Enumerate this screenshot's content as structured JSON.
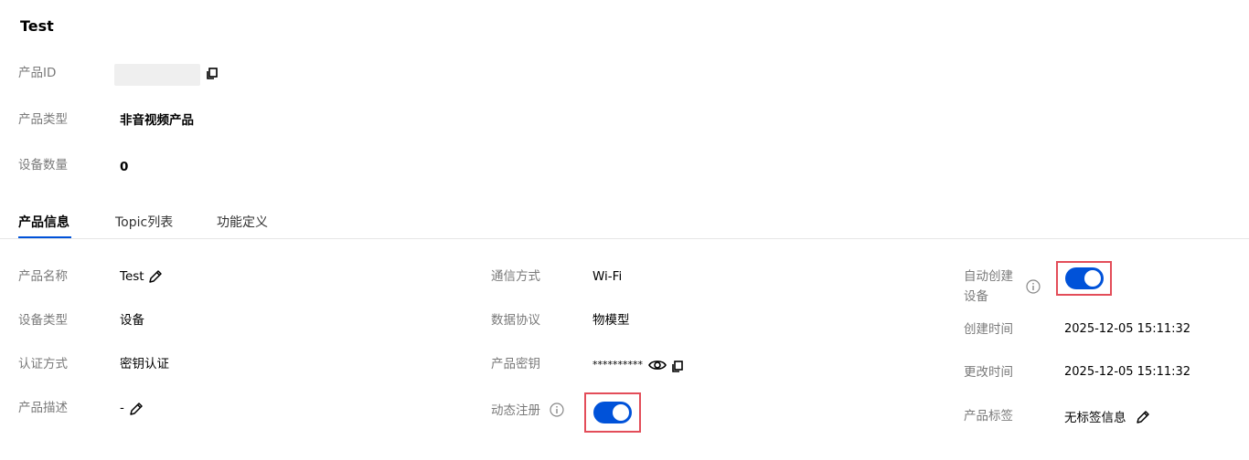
{
  "header": {
    "title": "Test"
  },
  "summary": {
    "product_id_label": "产品ID",
    "product_type_label": "产品类型",
    "product_type_value": "非音视频产品",
    "device_count_label": "设备数量",
    "device_count_value": "0"
  },
  "tabs": [
    {
      "label": "产品信息",
      "active": true
    },
    {
      "label": "Topic列表",
      "active": false
    },
    {
      "label": "功能定义",
      "active": false
    }
  ],
  "info": {
    "col1": {
      "name_label": "产品名称",
      "name_value": "Test",
      "device_type_label": "设备类型",
      "device_type_value": "设备",
      "auth_label": "认证方式",
      "auth_value": "密钥认证",
      "desc_label": "产品描述",
      "desc_value": "-"
    },
    "col2": {
      "comm_label": "通信方式",
      "comm_value": "Wi-Fi",
      "protocol_label": "数据协议",
      "protocol_value": "物模型",
      "secret_label": "产品密钥",
      "secret_value": "**********",
      "dynreg_label": "动态注册",
      "dynreg_on": true
    },
    "col3": {
      "autocreate_label_line1": "自动创建",
      "autocreate_label_line2": "设备",
      "autocreate_on": true,
      "created_label": "创建时间",
      "created_value": "2025-12-05 15:11:32",
      "updated_label": "更改时间",
      "updated_value": "2025-12-05 15:11:32",
      "tags_label": "产品标签",
      "tags_value": "无标签信息"
    }
  },
  "colors": {
    "accent": "#0052d9",
    "highlight": "#e34d59",
    "label": "#7a7a7a"
  }
}
